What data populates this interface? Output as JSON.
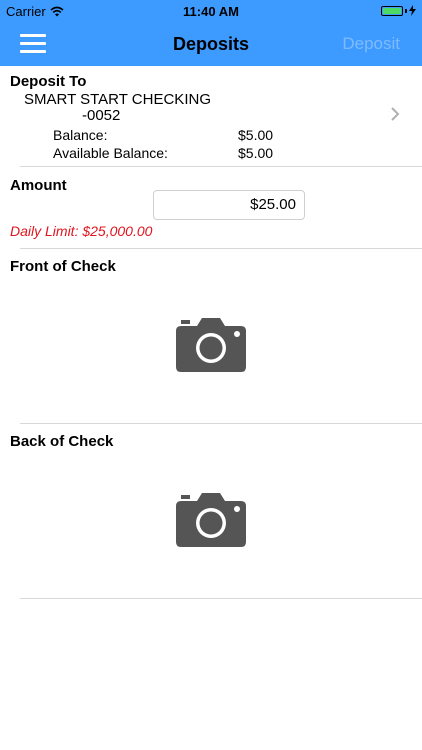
{
  "status_bar": {
    "carrier": "Carrier",
    "time": "11:40 AM"
  },
  "nav": {
    "title": "Deposits",
    "action_label": "Deposit"
  },
  "deposit_to": {
    "label": "Deposit To",
    "account_name": "SMART START CHECKING",
    "account_number": "-0052",
    "balance_label": "Balance:",
    "balance_value": "$5.00",
    "available_label": "Available Balance:",
    "available_value": "$5.00"
  },
  "amount": {
    "label": "Amount",
    "value": "$25.00",
    "daily_limit": "Daily Limit: $25,000.00"
  },
  "front_check": {
    "label": "Front of Check"
  },
  "back_check": {
    "label": "Back of Check"
  },
  "colors": {
    "accent": "#3d9bff",
    "limit_text": "#e0141e",
    "camera": "#555555"
  },
  "icons": [
    "menu-icon",
    "wifi-icon",
    "battery-icon",
    "chevron-right-icon",
    "camera-icon"
  ]
}
